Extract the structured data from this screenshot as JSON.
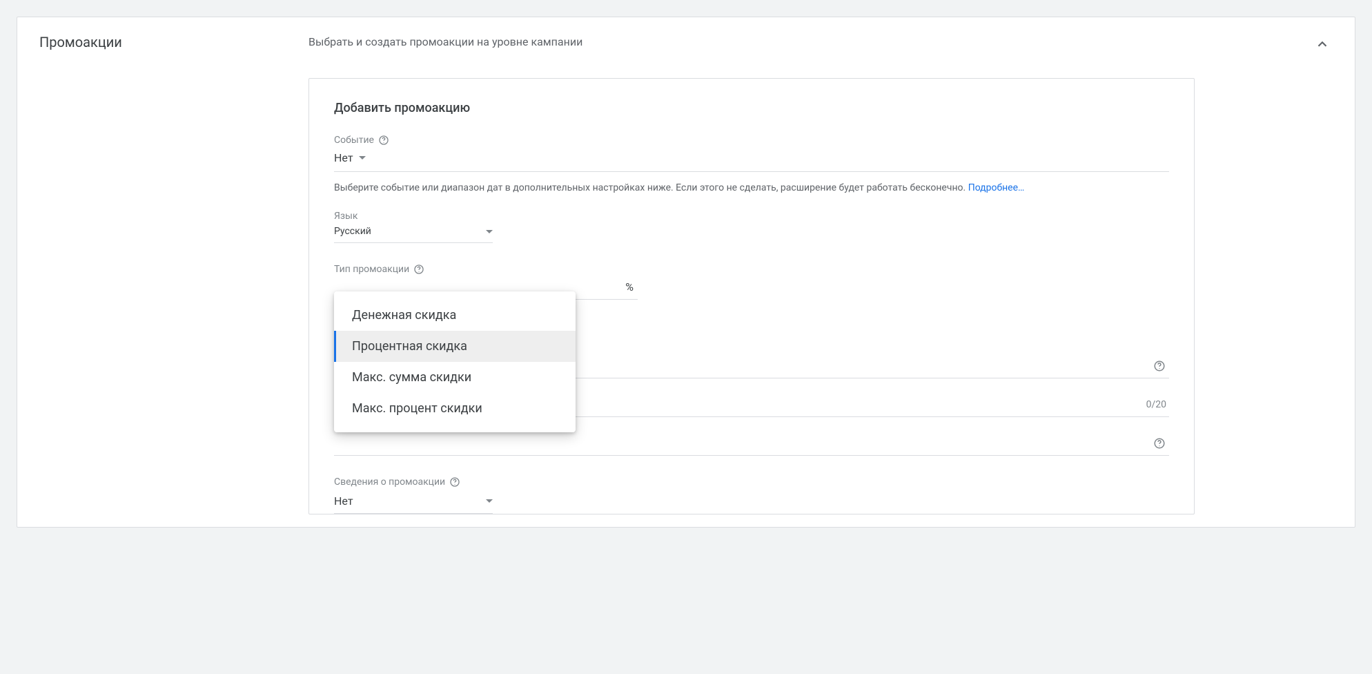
{
  "section": {
    "title": "Промоакции",
    "subtitle": "Выбрать и создать промоакции на уровне кампании"
  },
  "panel": {
    "title": "Добавить промоакцию",
    "event": {
      "label": "Событие",
      "value": "Нет",
      "hint_prefix": "Выберите событие или диапазон дат в дополнительных настройках ниже. Если этого не сделать, расширение будет работать бесконечно. ",
      "hint_link": "Подробнее…"
    },
    "language": {
      "label": "Язык",
      "value": "Русский"
    },
    "promo_type": {
      "label": "Тип промоакции",
      "percent_sign": "%",
      "options": [
        "Денежная скидка",
        "Процентная скидка",
        "Макс. сумма скидки",
        "Макс. процент скидки"
      ],
      "selected_index": 1
    },
    "counter": "0/20",
    "details": {
      "label": "Сведения о промоакции",
      "value": "Нет"
    }
  }
}
